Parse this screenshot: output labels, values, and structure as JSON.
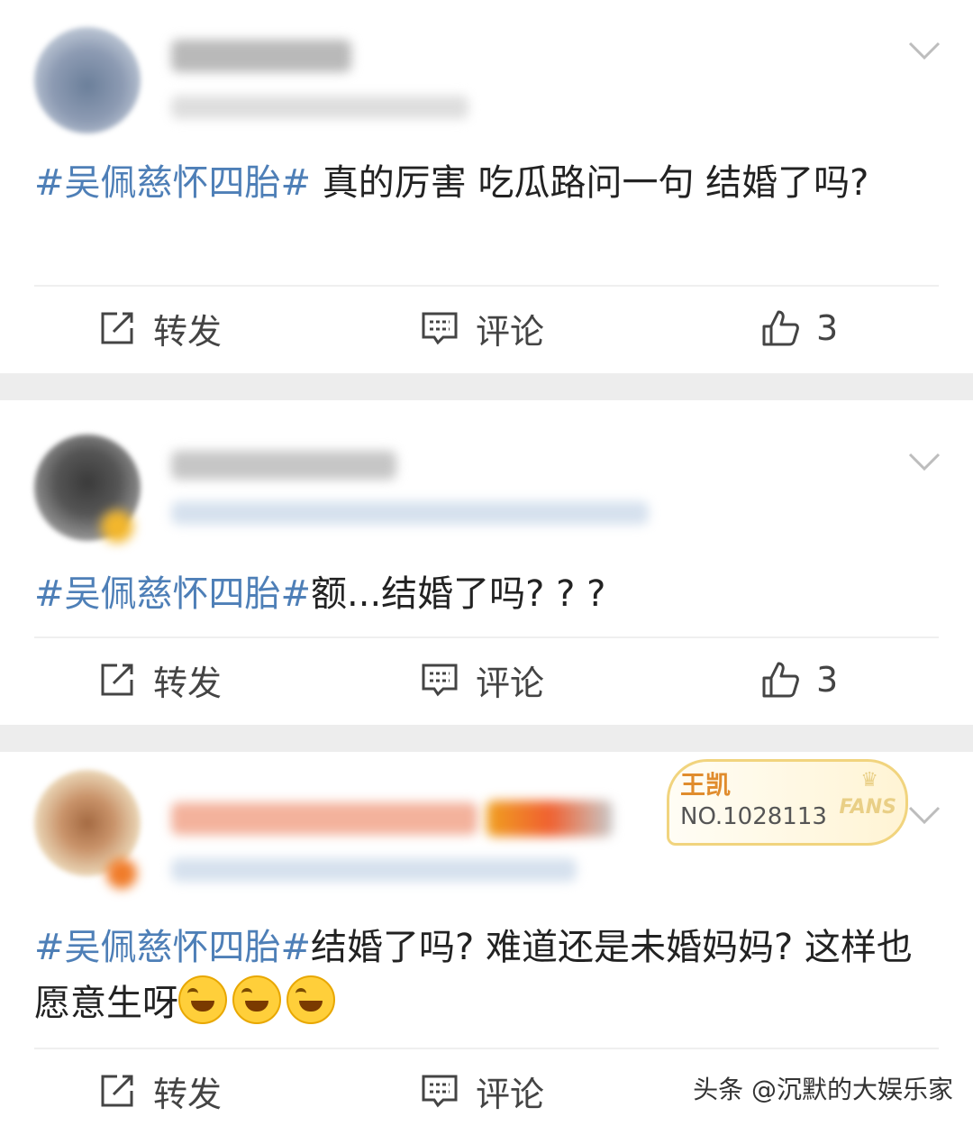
{
  "posts": [
    {
      "hashtag": "#吴佩慈怀四胎#",
      "text": "  真的厉害 吃瓜路问一句 结婚了吗?",
      "repost_label": "转发",
      "comment_label": "评论",
      "like_count": "3"
    },
    {
      "hashtag": "#吴佩慈怀四胎#",
      "text": "额...结婚了吗? ? ?",
      "repost_label": "转发",
      "comment_label": "评论",
      "like_count": "3"
    },
    {
      "hashtag": "#吴佩慈怀四胎#",
      "text": "结婚了吗? 难道还是未婚妈妈? 这样也愿意生呀",
      "fans_badge": {
        "name": "王凯",
        "number": "NO.1028113",
        "tag": "FANS"
      },
      "repost_label": "转发",
      "comment_label": "评论"
    }
  ],
  "watermark": "头条 @沉默的大娱乐家",
  "colors": {
    "hashtag": "#4e7fb7",
    "separator": "#ededed",
    "badge_border": "#f1d47e"
  },
  "icons": [
    "chevron-down-icon",
    "repost-icon",
    "comment-icon",
    "like-icon",
    "laugh-cry-emoji"
  ]
}
